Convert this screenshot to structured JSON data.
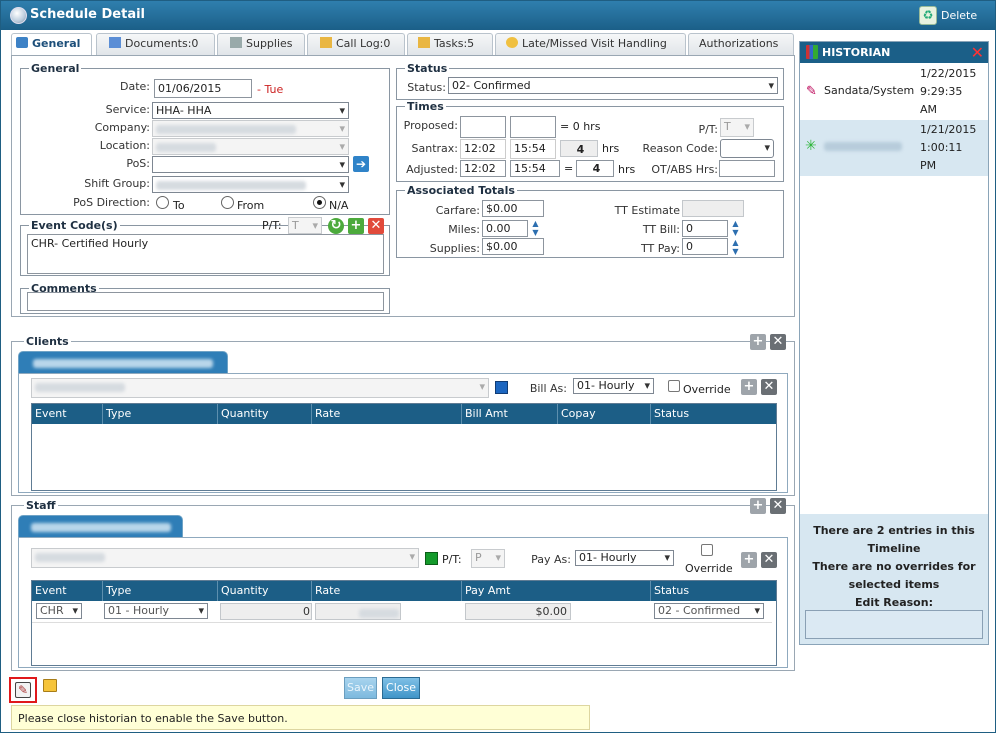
{
  "window": {
    "title": "Schedule Detail",
    "delete_label": "Delete"
  },
  "tabs": [
    "General",
    "Documents:0",
    "Supplies",
    "Call Log:0",
    "Tasks:5",
    "Late/Missed Visit Handling",
    "Authorizations"
  ],
  "general": {
    "legend": "General",
    "date_label": "Date:",
    "date_value": "01/06/2015",
    "day": "- Tue",
    "service_label": "Service:",
    "service_value": "HHA- HHA",
    "company_label": "Company:",
    "location_label": "Location:",
    "pos_label": "PoS:",
    "shift_group_label": "Shift Group:",
    "pos_direction_label": "PoS Direction:",
    "dir_to": "To",
    "dir_from": "From",
    "dir_na": "N/A",
    "pos_direction_selected": "N/A"
  },
  "event_codes": {
    "legend": "Event Code(s)",
    "pt_label": "P/T:",
    "pt_value": "T",
    "value": "CHR- Certified Hourly"
  },
  "comments": {
    "legend": "Comments"
  },
  "status": {
    "legend": "Status",
    "label": "Status:",
    "value": "02- Confirmed"
  },
  "times": {
    "legend": "Times",
    "proposed_label": "Proposed:",
    "proposed_hrs": "= 0 hrs",
    "pt_label": "P/T:",
    "pt_value": "T",
    "santrax_label": "Santrax:",
    "santrax_start": "12:02",
    "santrax_end": "15:54",
    "santrax_hours": "4",
    "hrs": "hrs",
    "reason_code_label": "Reason Code:",
    "adjusted_label": "Adjusted:",
    "adjusted_start": "12:02",
    "adjusted_end": "15:54",
    "eq": "=",
    "adjusted_hours": "4",
    "otabs_label": "OT/ABS Hrs:"
  },
  "totals": {
    "legend": "Associated Totals",
    "carfare_label": "Carfare:",
    "carfare": "$0.00",
    "miles_label": "Miles:",
    "miles": "0.00",
    "supplies_label": "Supplies:",
    "supplies": "$0.00",
    "tt_estimate_label": "TT Estimate",
    "tt_bill_label": "TT Bill:",
    "tt_bill": "0",
    "tt_pay_label": "TT Pay:",
    "tt_pay": "0"
  },
  "clients": {
    "title": "Clients",
    "bill_as_label": "Bill As:",
    "bill_as_value": "01- Hourly",
    "override_label": "Override",
    "columns": [
      "Event",
      "Type",
      "Quantity",
      "Rate",
      "Bill Amt",
      "Copay",
      "Status"
    ]
  },
  "staff": {
    "title": "Staff",
    "pt_label": "P/T:",
    "pt_value": "P",
    "pay_as_label": "Pay As:",
    "pay_as_value": "01- Hourly",
    "override_label": "Override",
    "columns": [
      "Event",
      "Type",
      "Quantity",
      "Rate",
      "Pay Amt",
      "Status"
    ],
    "row": {
      "event": "CHR",
      "type": "01 - Hourly",
      "quantity": "0",
      "pay_amt": "$0.00",
      "status": "02 - Confirmed"
    }
  },
  "footer": {
    "save_label": "Save",
    "close_label": "Close",
    "warning": "Please close historian to enable the Save button."
  },
  "historian": {
    "title": "HISTORIAN",
    "entries": [
      {
        "date": "1/22/2015",
        "time": "9:29:35",
        "ampm": "AM",
        "user": "Sandata/System"
      },
      {
        "date": "1/21/2015",
        "time": "1:00:11",
        "ampm": "PM",
        "user": ""
      }
    ],
    "summary_line1": "There are 2 entries in this",
    "summary_line2": "Timeline",
    "summary_line3": "There are no overrides for",
    "summary_line4": "selected items",
    "edit_reason_label": "Edit Reason:"
  }
}
